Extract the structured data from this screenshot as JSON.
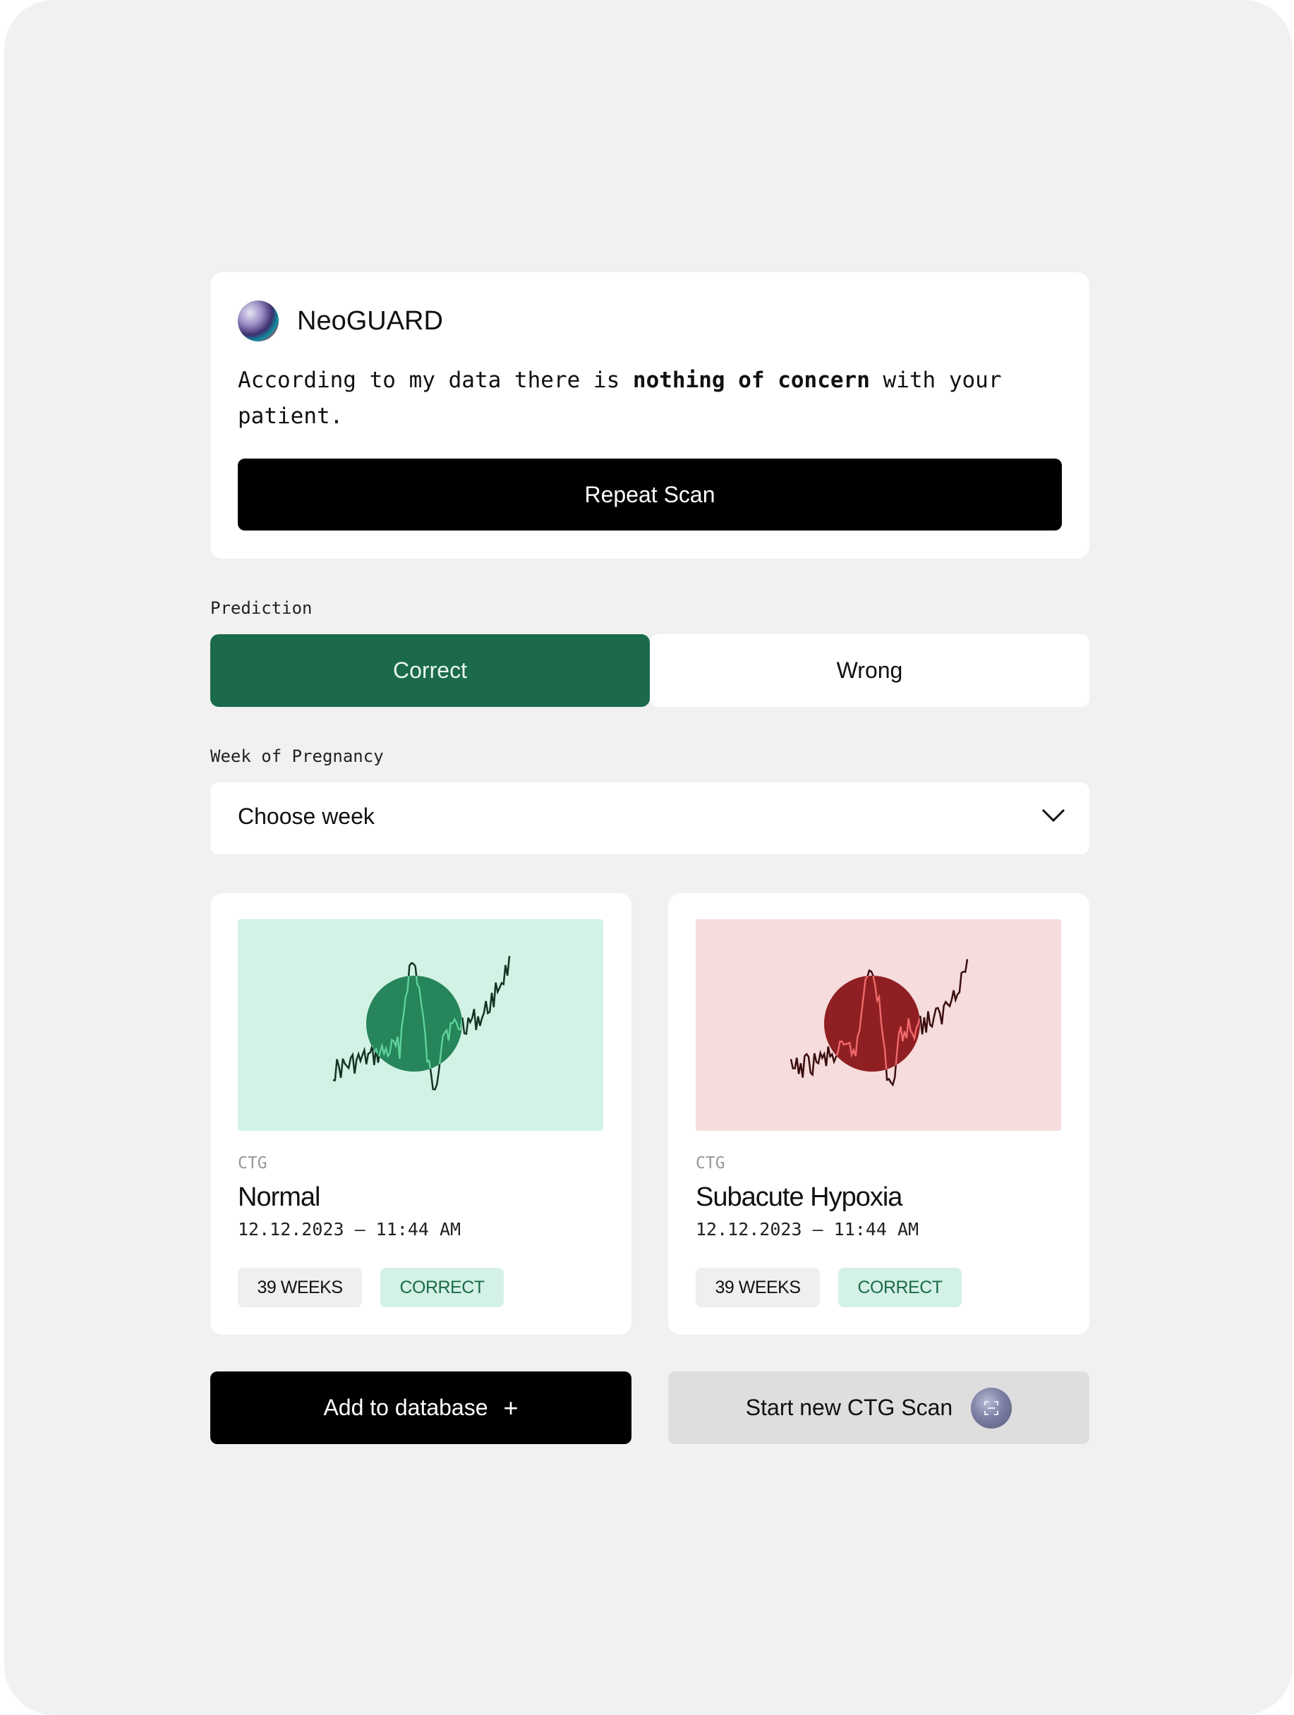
{
  "assistant": {
    "name": "NeoGUARD",
    "message_before": "According to my data there is ",
    "message_bold": "nothing of concern",
    "message_after": " with your patient.",
    "repeat_button": "Repeat Scan"
  },
  "prediction": {
    "label": "Prediction",
    "options": [
      "Correct",
      "Wrong"
    ],
    "selected": "Correct"
  },
  "week": {
    "label": "Week of Pregnancy",
    "placeholder": "Choose week"
  },
  "results": [
    {
      "type_label": "CTG",
      "title": "Normal",
      "datetime": "12.12.2023 – 11:44 AM",
      "weeks_tag": "39 WEEKS",
      "status_tag": "CORRECT",
      "theme": {
        "bg": "#d3f2e6",
        "circle": "#26855a",
        "line": "#123524",
        "line_inner": "#5fd39a"
      }
    },
    {
      "type_label": "CTG",
      "title": "Subacute Hypoxia",
      "datetime": "12.12.2023 – 11:44 AM",
      "weeks_tag": "39 WEEKS",
      "status_tag": "CORRECT",
      "theme": {
        "bg": "#f6dcdc",
        "circle": "#8f1f22",
        "line": "#3a0d0e",
        "line_inner": "#f2686a"
      }
    }
  ],
  "actions": {
    "add_button": "Add to database",
    "add_icon": "+",
    "scan_button": "Start new CTG Scan"
  },
  "colors": {
    "accent_green": "#1a6a4b",
    "tag_green_bg": "#d4f1e6"
  }
}
